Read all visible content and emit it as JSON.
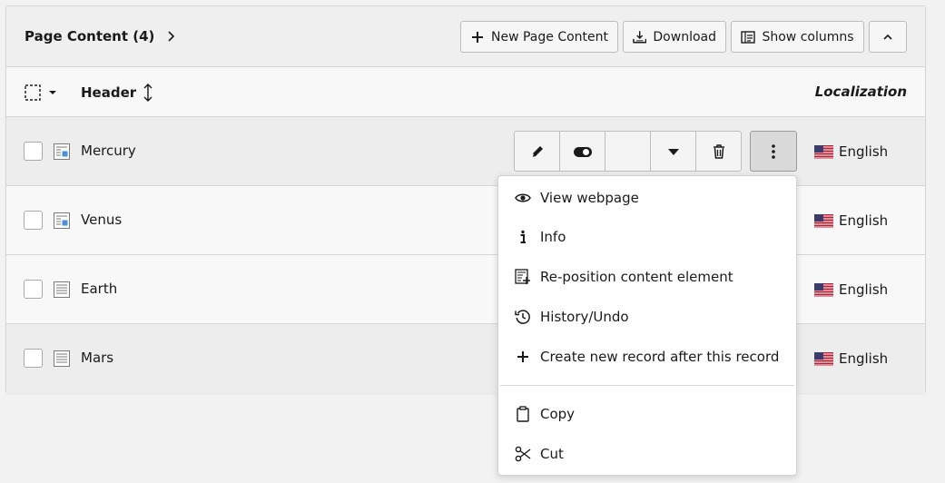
{
  "header": {
    "title": "Page Content (4)",
    "new_label": "New Page Content",
    "download_label": "Download",
    "columns_label": "Show columns"
  },
  "columns": {
    "header_label": "Header",
    "localization_label": "Localization"
  },
  "rows": [
    {
      "title": "Mercury",
      "language": "English",
      "icon": "content-image-icon"
    },
    {
      "title": "Venus",
      "language": "English",
      "icon": "content-image-icon"
    },
    {
      "title": "Earth",
      "language": "English",
      "icon": "content-text-icon"
    },
    {
      "title": "Mars",
      "language": "English",
      "icon": "content-text-icon"
    }
  ],
  "row_actions": [
    "edit-icon",
    "toggle-icon",
    "blank",
    "caret-down-icon",
    "trash-icon"
  ],
  "context_menu": {
    "items": [
      {
        "label": "View webpage",
        "icon": "eye-icon"
      },
      {
        "label": "Info",
        "icon": "info-icon"
      },
      {
        "label": "Re-position content element",
        "icon": "reposition-icon"
      },
      {
        "label": "History/Undo",
        "icon": "history-icon"
      },
      {
        "label": "Create new record after this record",
        "icon": "plus-icon"
      },
      {
        "label": "Copy",
        "icon": "clipboard-icon"
      },
      {
        "label": "Cut",
        "icon": "scissors-icon"
      }
    ]
  },
  "colors": {
    "panel_bg": "#fafafa",
    "header_bg": "#efefef",
    "border": "#d7d7d7",
    "active_button": "#d9d9d9"
  }
}
